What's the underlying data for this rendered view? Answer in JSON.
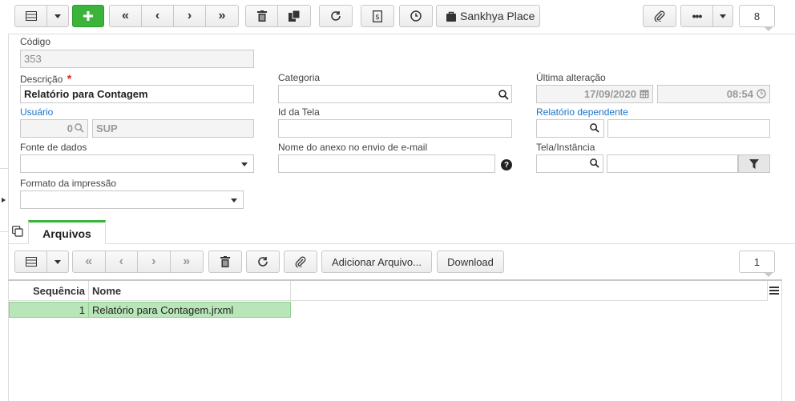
{
  "toolbar": {
    "place_label": "Sankhya Place",
    "counter": "8"
  },
  "form": {
    "codigo_label": "Código",
    "codigo_value": "353",
    "descricao_label": "Descrição",
    "required_mark": "*",
    "descricao_value": "Relatório para Contagem",
    "categoria_label": "Categoria",
    "ultima_alteracao_label": "Última alteração",
    "date_value": "17/09/2020",
    "time_value": "08:54",
    "usuario_label": "Usuário",
    "usuario_code": "0",
    "usuario_name": "SUP",
    "id_tela_label": "Id da Tela",
    "relatorio_dep_label": "Relatório dependente",
    "fonte_label": "Fonte de dados",
    "nome_anexo_label": "Nome do anexo no envio de e-mail",
    "tela_instancia_label": "Tela/Instância",
    "formato_label": "Formato da impressão"
  },
  "tab": {
    "label": "Arquivos"
  },
  "grid_toolbar": {
    "add_file_label": "Adicionar Arquivo...",
    "download_label": "Download",
    "counter": "1"
  },
  "grid": {
    "columns": [
      "Sequência",
      "Nome"
    ],
    "rows": [
      {
        "seq": "1",
        "name": "Relatório para Contagem.jrxml"
      }
    ]
  },
  "colors": {
    "accent_green": "#3cb43c",
    "link_blue": "#1a73c8",
    "selected_row": "#b8e6b8"
  },
  "icons": [
    "grid-icon",
    "plus-icon",
    "first-icon",
    "prev-icon",
    "next-icon",
    "last-icon",
    "trash-icon",
    "copy-icon",
    "refresh-icon",
    "report-icon",
    "clock-icon",
    "bag-icon",
    "paperclip-icon",
    "more-icon",
    "search-icon",
    "calendar-icon",
    "help-icon",
    "filter-icon",
    "tab-copy-icon"
  ]
}
